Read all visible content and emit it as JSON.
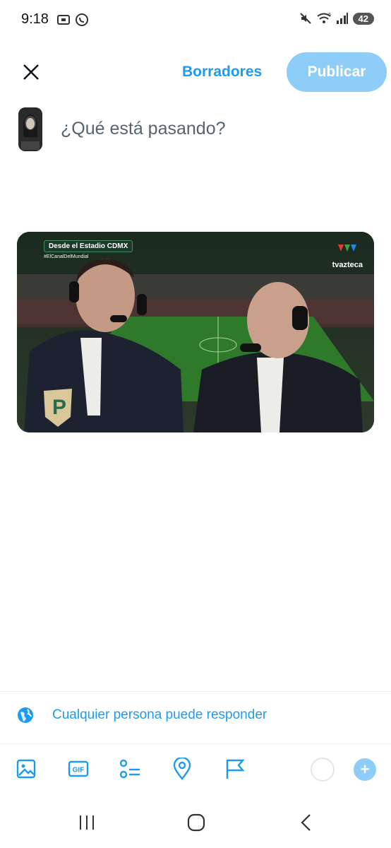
{
  "status_bar": {
    "time": "9:18",
    "battery": "42",
    "wifi_badge": "6"
  },
  "header": {
    "drafts_label": "Borradores",
    "publish_label": "Publicar"
  },
  "compose": {
    "placeholder": "¿Qué está pasando?"
  },
  "media": {
    "caption_title": "Desde el Estadio CDMX",
    "caption_hashtag": "#ElCanalDelMundial",
    "brand": "tvazteca"
  },
  "reply_setting": {
    "label": "Cualquier persona puede responder"
  },
  "toolbar": {
    "icons": [
      "image-icon",
      "gif-icon",
      "poll-icon",
      "location-icon",
      "flag-icon"
    ],
    "gif_label": "GIF"
  },
  "colors": {
    "accent": "#1d9bf0",
    "accent_light": "#8ecdf8",
    "placeholder": "#536471"
  }
}
